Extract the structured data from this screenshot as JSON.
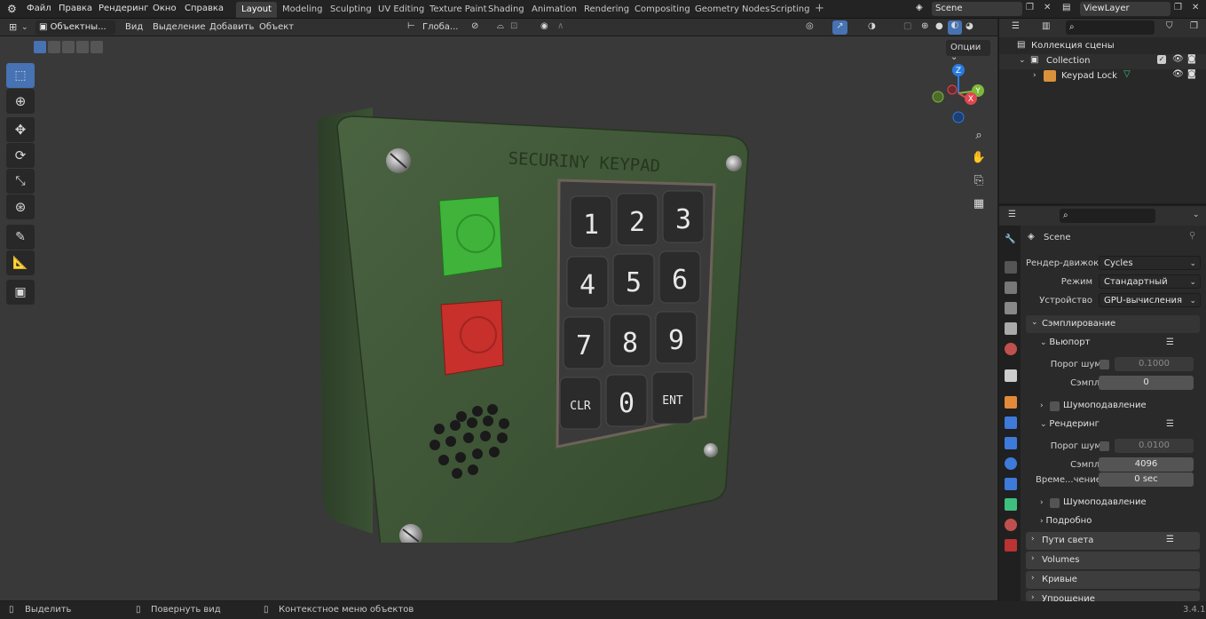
{
  "menu": {
    "items": [
      "Файл",
      "Правка",
      "Рендеринг",
      "Окно",
      "Справка"
    ]
  },
  "workspaces": [
    "Layout",
    "Modeling",
    "Sculpting",
    "UV Editing",
    "Texture Paint",
    "Shading",
    "Animation",
    "Rendering",
    "Compositing",
    "Geometry Nodes",
    "Scripting"
  ],
  "workspace_active": "Layout",
  "scene": {
    "name": "Scene",
    "view_layer": "ViewLayer"
  },
  "viewport_header": {
    "mode": "Объектны...",
    "view": "Вид",
    "select": "Выделение",
    "add": "Добавить",
    "object": "Объект",
    "orientation": "Глоба...",
    "options": "Опции"
  },
  "gizmo": {
    "x": "X",
    "y": "Y",
    "z": "Z"
  },
  "model": {
    "label": "SECURINY KEYPAD",
    "keys": [
      "1",
      "2",
      "3",
      "4",
      "5",
      "6",
      "7",
      "8",
      "9",
      "CLR",
      "0",
      "ENT"
    ]
  },
  "outliner": {
    "scene_collection": "Коллекция сцены",
    "collection": "Collection",
    "object": "Keypad Lock"
  },
  "properties": {
    "context": "Scene",
    "engine_label": "Рендер-движок",
    "engine": "Cycles",
    "mode_label": "Режим",
    "mode": "Стандартный",
    "device_label": "Устройство",
    "device": "GPU-вычисления",
    "sampling": "Сэмплирование",
    "viewport": "Вьюпорт",
    "noise_threshold_label": "Порог шума",
    "vp_noise": "0.1000",
    "samples_label": "Сэмплы",
    "vp_samples": "0",
    "denoise": "Шумоподавление",
    "render": "Рендеринг",
    "r_noise": "0.0100",
    "r_samples": "4096",
    "time_limit_label": "Време...чениeё",
    "time_limit": "0 sec",
    "r_denoise": "Шумоподавление",
    "advanced": "Подробно",
    "light_paths": "Пути света",
    "volumes": "Volumes",
    "curves": "Кривые",
    "simplify": "Упрощение"
  },
  "status": {
    "select": "Выделить",
    "rotate": "Повернуть вид",
    "context_menu": "Контекстное меню объектов",
    "version": "3.4.1"
  },
  "colors": {
    "accent": "#4772b3",
    "keypad_body": "#3d5535",
    "green_button": "#3fb33a",
    "red_button": "#c8302c"
  }
}
